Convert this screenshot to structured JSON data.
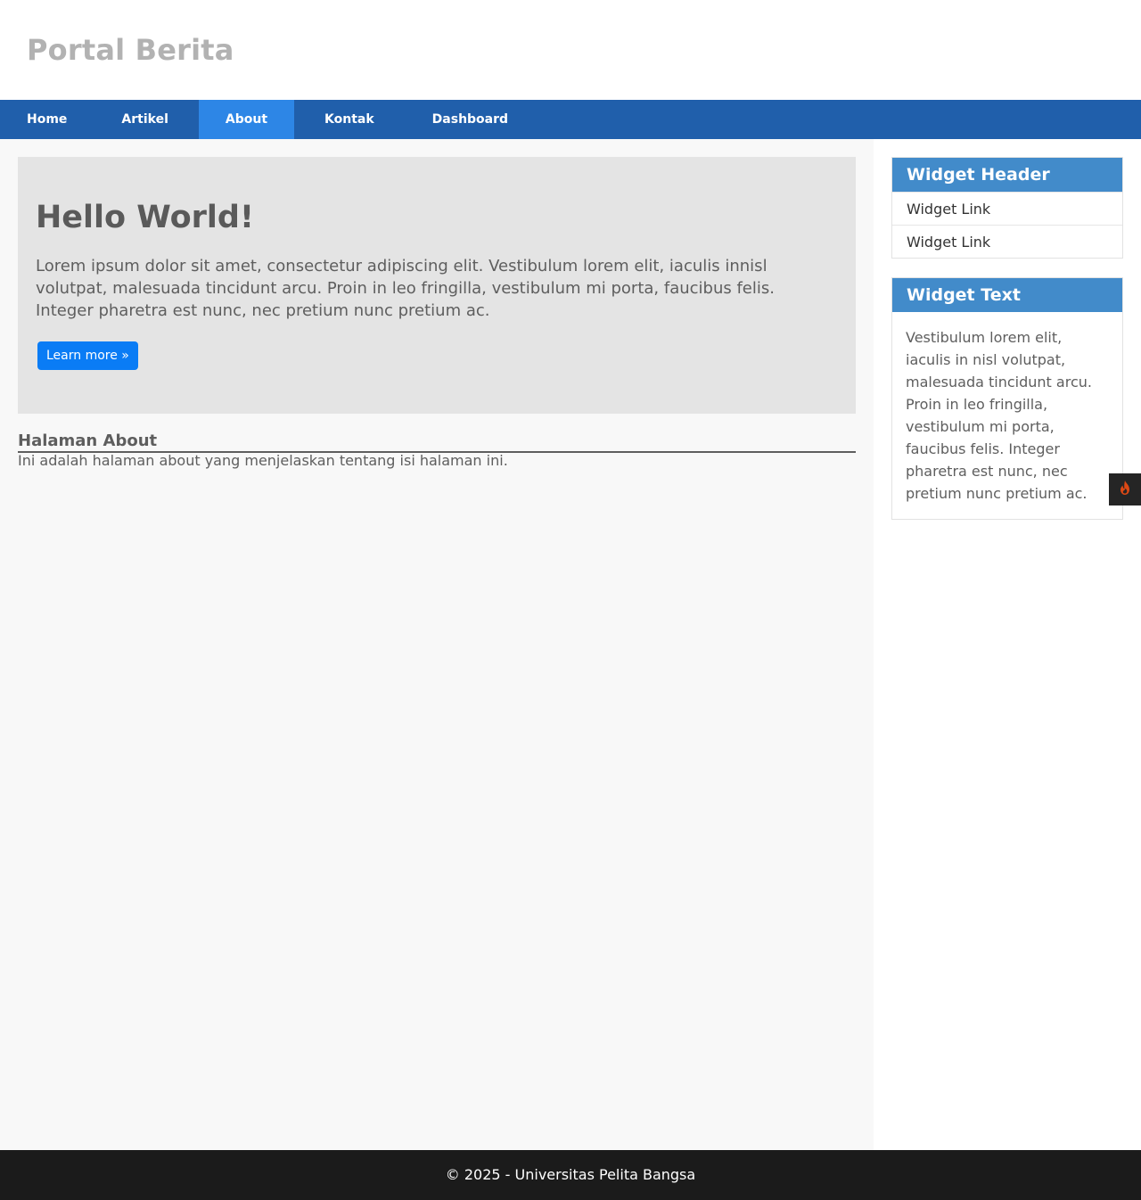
{
  "site": {
    "title": "Portal Berita"
  },
  "nav": {
    "items": [
      {
        "label": "Home"
      },
      {
        "label": "Artikel"
      },
      {
        "label": "About"
      },
      {
        "label": "Kontak"
      },
      {
        "label": "Dashboard"
      }
    ],
    "active": "About"
  },
  "hero": {
    "title": "Hello World!",
    "text": "Lorem ipsum dolor sit amet, consectetur adipiscing elit. Vestibulum lorem elit, iaculis innisl volutpat, malesuada tincidunt arcu. Proin in leo fringilla, vestibulum mi porta, faucibus felis. Integer pharetra est nunc, nec pretium nunc pretium ac.",
    "button_label": "Learn more »"
  },
  "about": {
    "title": "Halaman About",
    "text": "Ini adalah halaman about yang menjelaskan tentang isi halaman ini."
  },
  "sidebar": {
    "widget_links": {
      "header": "Widget Header",
      "links": [
        {
          "label": "Widget Link"
        },
        {
          "label": "Widget Link"
        }
      ]
    },
    "widget_text": {
      "header": "Widget Text",
      "text": "Vestibulum lorem elit, iaculis in nisl volutpat, malesuada tincidunt arcu. Proin in leo fringilla, vestibulum mi porta, faucibus felis. Integer pharetra est nunc, nec pretium nunc pretium ac."
    }
  },
  "footer": {
    "text": "© 2025 - Universitas Pelita Bangsa"
  },
  "icons": {
    "debug_toolbar": "flame-icon"
  },
  "colors": {
    "nav_bg": "#205fab",
    "nav_active": "#2d86e6",
    "widget_header": "#428bca",
    "button": "#0a7cf5",
    "footer_bg": "#1b1b1b",
    "flame": "#dd4814"
  }
}
